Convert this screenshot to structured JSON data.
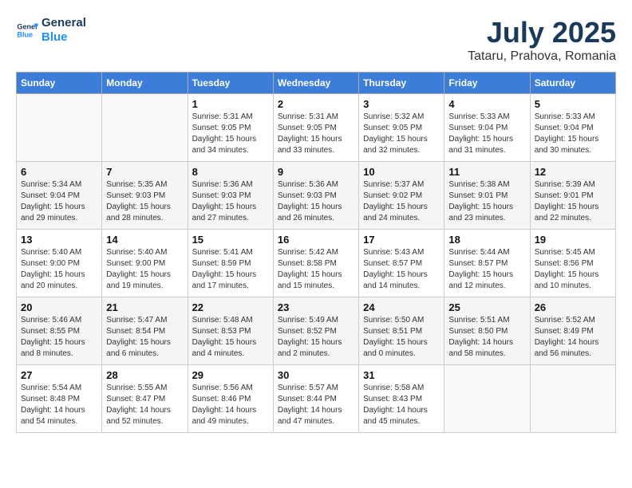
{
  "header": {
    "logo_line1": "General",
    "logo_line2": "Blue",
    "title": "July 2025",
    "subtitle": "Tataru, Prahova, Romania"
  },
  "calendar": {
    "days_of_week": [
      "Sunday",
      "Monday",
      "Tuesday",
      "Wednesday",
      "Thursday",
      "Friday",
      "Saturday"
    ],
    "weeks": [
      [
        {
          "day": "",
          "info": ""
        },
        {
          "day": "",
          "info": ""
        },
        {
          "day": "1",
          "info": "Sunrise: 5:31 AM\nSunset: 9:05 PM\nDaylight: 15 hours and 34 minutes."
        },
        {
          "day": "2",
          "info": "Sunrise: 5:31 AM\nSunset: 9:05 PM\nDaylight: 15 hours and 33 minutes."
        },
        {
          "day": "3",
          "info": "Sunrise: 5:32 AM\nSunset: 9:05 PM\nDaylight: 15 hours and 32 minutes."
        },
        {
          "day": "4",
          "info": "Sunrise: 5:33 AM\nSunset: 9:04 PM\nDaylight: 15 hours and 31 minutes."
        },
        {
          "day": "5",
          "info": "Sunrise: 5:33 AM\nSunset: 9:04 PM\nDaylight: 15 hours and 30 minutes."
        }
      ],
      [
        {
          "day": "6",
          "info": "Sunrise: 5:34 AM\nSunset: 9:04 PM\nDaylight: 15 hours and 29 minutes."
        },
        {
          "day": "7",
          "info": "Sunrise: 5:35 AM\nSunset: 9:03 PM\nDaylight: 15 hours and 28 minutes."
        },
        {
          "day": "8",
          "info": "Sunrise: 5:36 AM\nSunset: 9:03 PM\nDaylight: 15 hours and 27 minutes."
        },
        {
          "day": "9",
          "info": "Sunrise: 5:36 AM\nSunset: 9:03 PM\nDaylight: 15 hours and 26 minutes."
        },
        {
          "day": "10",
          "info": "Sunrise: 5:37 AM\nSunset: 9:02 PM\nDaylight: 15 hours and 24 minutes."
        },
        {
          "day": "11",
          "info": "Sunrise: 5:38 AM\nSunset: 9:01 PM\nDaylight: 15 hours and 23 minutes."
        },
        {
          "day": "12",
          "info": "Sunrise: 5:39 AM\nSunset: 9:01 PM\nDaylight: 15 hours and 22 minutes."
        }
      ],
      [
        {
          "day": "13",
          "info": "Sunrise: 5:40 AM\nSunset: 9:00 PM\nDaylight: 15 hours and 20 minutes."
        },
        {
          "day": "14",
          "info": "Sunrise: 5:40 AM\nSunset: 9:00 PM\nDaylight: 15 hours and 19 minutes."
        },
        {
          "day": "15",
          "info": "Sunrise: 5:41 AM\nSunset: 8:59 PM\nDaylight: 15 hours and 17 minutes."
        },
        {
          "day": "16",
          "info": "Sunrise: 5:42 AM\nSunset: 8:58 PM\nDaylight: 15 hours and 15 minutes."
        },
        {
          "day": "17",
          "info": "Sunrise: 5:43 AM\nSunset: 8:57 PM\nDaylight: 15 hours and 14 minutes."
        },
        {
          "day": "18",
          "info": "Sunrise: 5:44 AM\nSunset: 8:57 PM\nDaylight: 15 hours and 12 minutes."
        },
        {
          "day": "19",
          "info": "Sunrise: 5:45 AM\nSunset: 8:56 PM\nDaylight: 15 hours and 10 minutes."
        }
      ],
      [
        {
          "day": "20",
          "info": "Sunrise: 5:46 AM\nSunset: 8:55 PM\nDaylight: 15 hours and 8 minutes."
        },
        {
          "day": "21",
          "info": "Sunrise: 5:47 AM\nSunset: 8:54 PM\nDaylight: 15 hours and 6 minutes."
        },
        {
          "day": "22",
          "info": "Sunrise: 5:48 AM\nSunset: 8:53 PM\nDaylight: 15 hours and 4 minutes."
        },
        {
          "day": "23",
          "info": "Sunrise: 5:49 AM\nSunset: 8:52 PM\nDaylight: 15 hours and 2 minutes."
        },
        {
          "day": "24",
          "info": "Sunrise: 5:50 AM\nSunset: 8:51 PM\nDaylight: 15 hours and 0 minutes."
        },
        {
          "day": "25",
          "info": "Sunrise: 5:51 AM\nSunset: 8:50 PM\nDaylight: 14 hours and 58 minutes."
        },
        {
          "day": "26",
          "info": "Sunrise: 5:52 AM\nSunset: 8:49 PM\nDaylight: 14 hours and 56 minutes."
        }
      ],
      [
        {
          "day": "27",
          "info": "Sunrise: 5:54 AM\nSunset: 8:48 PM\nDaylight: 14 hours and 54 minutes."
        },
        {
          "day": "28",
          "info": "Sunrise: 5:55 AM\nSunset: 8:47 PM\nDaylight: 14 hours and 52 minutes."
        },
        {
          "day": "29",
          "info": "Sunrise: 5:56 AM\nSunset: 8:46 PM\nDaylight: 14 hours and 49 minutes."
        },
        {
          "day": "30",
          "info": "Sunrise: 5:57 AM\nSunset: 8:44 PM\nDaylight: 14 hours and 47 minutes."
        },
        {
          "day": "31",
          "info": "Sunrise: 5:58 AM\nSunset: 8:43 PM\nDaylight: 14 hours and 45 minutes."
        },
        {
          "day": "",
          "info": ""
        },
        {
          "day": "",
          "info": ""
        }
      ]
    ]
  }
}
